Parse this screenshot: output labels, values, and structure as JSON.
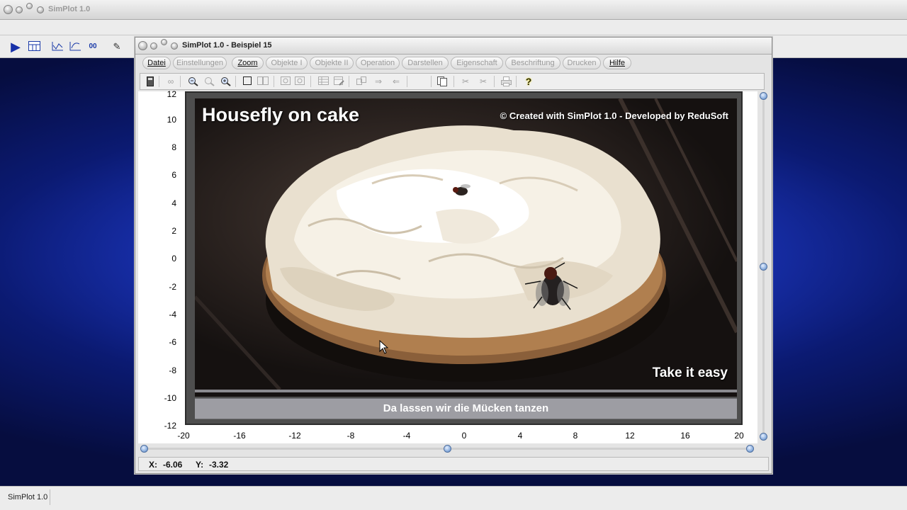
{
  "main_window": {
    "title": "SimPlot 1.0",
    "status_text": "SimPlot 1.0"
  },
  "child_window": {
    "title": "SimPlot 1.0 - Beispiel 15",
    "menu": [
      {
        "label": "Datei",
        "active": true
      },
      {
        "label": "Einstellungen",
        "active": false
      },
      {
        "label": "Zoom",
        "active": true
      },
      {
        "label": "Objekte I",
        "active": false
      },
      {
        "label": "Objekte II",
        "active": false
      },
      {
        "label": "Operation",
        "active": false
      },
      {
        "label": "Darstellen",
        "active": false
      },
      {
        "label": "Eigenschaft",
        "active": false
      },
      {
        "label": "Beschriftung",
        "active": false
      },
      {
        "label": "Drucken",
        "active": false
      },
      {
        "label": "Hilfe",
        "active": true
      }
    ]
  },
  "plot": {
    "y_ticks": [
      "12",
      "10",
      "8",
      "6",
      "4",
      "2",
      "0",
      "-2",
      "-4",
      "-6",
      "-8",
      "-10",
      "-12"
    ],
    "x_ticks": [
      "-20",
      "-16",
      "-12",
      "-8",
      "-4",
      "0",
      "4",
      "8",
      "12",
      "16",
      "20"
    ],
    "image_title": "Housefly on cake",
    "image_credit": "© Created with SimPlot 1.0 - Developed by ReduSoft",
    "image_tagline": "Take it easy",
    "caption": "Da lassen wir die Mücken tanzen"
  },
  "status": {
    "x_label": "X:",
    "x_value": "-6.06",
    "y_label": "Y:",
    "y_value": "-3.32"
  },
  "icons": {
    "main_toolbar": [
      "play-icon",
      "grid-calc-icon",
      "line-chart-icon",
      "xy-chart-icon",
      "data-points-icon",
      "pen-icon"
    ],
    "child_toolbar": [
      "calculator-icon",
      "glasses-icon",
      "zoom-out-icon",
      "zoom-reset-icon",
      "zoom-in-icon",
      "square-icon",
      "double-square-icon",
      "frame-icon",
      "frame2-icon",
      "table-icon",
      "table-edit-icon",
      "copy-range-icon",
      "arrow-right-icon",
      "arrow-left-icon",
      "pages-icon",
      "cut-icon",
      "cut2-icon",
      "printer-icon",
      "help-icon"
    ]
  },
  "colors": {
    "desktop_accent": "#1a33b6",
    "caption_bg": "#9d9da3"
  }
}
